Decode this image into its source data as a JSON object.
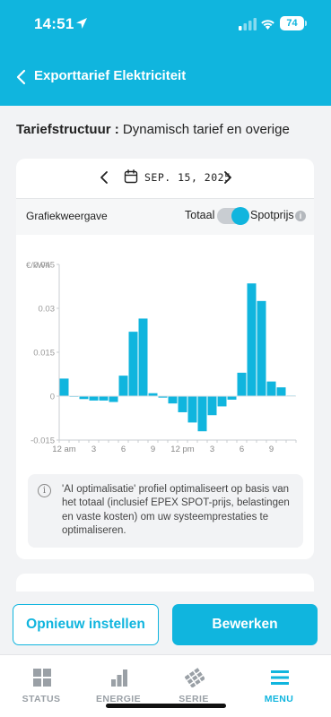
{
  "status_bar": {
    "time": "14:51",
    "battery": "74"
  },
  "header": {
    "title": "Exporttarief Elektriciteit"
  },
  "tariff": {
    "label": "Tariefstructuur :",
    "value": "Dynamisch tarief en overige"
  },
  "date_nav": {
    "date": "SEP. 15, 2025"
  },
  "view": {
    "label": "Grafiekweergave",
    "option_left": "Totaal",
    "option_right": "Spotprijs",
    "selected": "Spotprijs"
  },
  "chart_data": {
    "type": "bar",
    "unit_label": "€/kWh",
    "ylim": [
      -0.015,
      0.045
    ],
    "yticks": [
      "0.045",
      "0.03",
      "0.015",
      "0",
      "-0.015"
    ],
    "xtick_labels": [
      "12 am",
      "3",
      "6",
      "9",
      "12 pm",
      "3",
      "6",
      "9"
    ],
    "hours": [
      0,
      1,
      2,
      3,
      4,
      5,
      6,
      7,
      8,
      9,
      10,
      11,
      12,
      13,
      14,
      15,
      16,
      17,
      18,
      19,
      20,
      21,
      22,
      23
    ],
    "values": [
      0.006,
      0.0,
      -0.001,
      -0.0015,
      -0.0015,
      -0.002,
      0.007,
      0.022,
      0.0265,
      0.001,
      -0.0005,
      -0.0025,
      -0.0055,
      -0.009,
      -0.012,
      -0.0065,
      -0.0035,
      -0.0012,
      0.008,
      0.0385,
      0.0325,
      0.005,
      0.003,
      0.0002
    ],
    "color": "#10b5de",
    "grid": false
  },
  "note": {
    "text": "'AI optimalisatie' profiel optimaliseert op basis van het totaal (inclusief EPEX SPOT-prijs, belastingen en vaste kosten) om uw systeemprestaties te optimaliseren."
  },
  "actions": {
    "reset": "Opnieuw instellen",
    "edit": "Bewerken"
  },
  "tabs": [
    {
      "label": "STATUS",
      "icon": "grid-icon"
    },
    {
      "label": "ENERGIE",
      "icon": "bar-chart-icon"
    },
    {
      "label": "SERIE",
      "icon": "solar-panel-icon"
    },
    {
      "label": "MENU",
      "icon": "menu-icon"
    }
  ],
  "colors": {
    "accent": "#10b5de",
    "inactive": "#9aa0a6"
  }
}
